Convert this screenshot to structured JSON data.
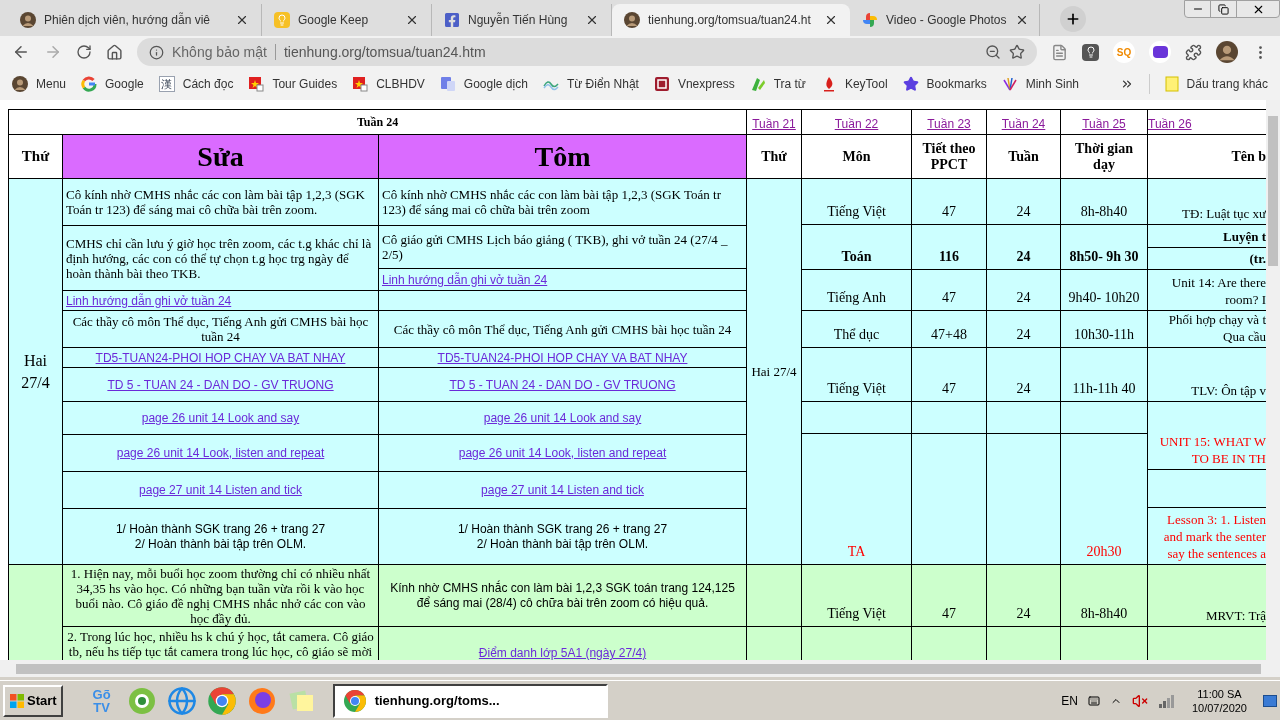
{
  "tabs": [
    {
      "title": "Phiên dịch viên, hướng dẫn viê",
      "kind": "avatar",
      "selected": false
    },
    {
      "title": "Google Keep",
      "kind": "keep",
      "selected": false
    },
    {
      "title": "Nguyễn Tiến Hùng",
      "kind": "facebook",
      "selected": false
    },
    {
      "title": "tienhung.org/tomsua/tuan24.ht",
      "kind": "avatar",
      "selected": true
    },
    {
      "title": "Video - Google Photos",
      "kind": "photos",
      "selected": false
    }
  ],
  "address_bar": {
    "security": "Không bảo mật",
    "url": "tienhung.org/tomsua/tuan24.htm"
  },
  "extension_badge": "SQ",
  "bookmarks": [
    {
      "label": "Menu",
      "kind": "avatar"
    },
    {
      "label": "Google",
      "kind": "google"
    },
    {
      "label": "Cách đọc",
      "kind": "glyph",
      "glyph": "漢"
    },
    {
      "label": "Tour Guides",
      "kind": "flag"
    },
    {
      "label": "CLBHDV",
      "kind": "flag"
    },
    {
      "label": "Google dịch",
      "kind": "translate"
    },
    {
      "label": "Từ Điển Nhật",
      "kind": "wave"
    },
    {
      "label": "Vnexpress",
      "kind": "news"
    },
    {
      "label": "Tra từ",
      "kind": "leaf"
    },
    {
      "label": "KeyTool",
      "kind": "flame"
    },
    {
      "label": "Bookmarks",
      "kind": "star"
    },
    {
      "label": "Minh Sinh",
      "kind": "fan"
    }
  ],
  "other_bookmarks": "Dấu trang khác",
  "left_table": {
    "title": "Tuần 24",
    "headers": [
      "Thứ",
      "Sửa",
      "Tôm"
    ],
    "blocks": [
      {
        "day": "Hai 27/4",
        "sua": [
          {
            "kind": "text",
            "text": "Cô kính nhờ CMHS nhắc các con làm bài tập 1,2,3 (SGK Toán tr 123) để sáng mai cô chữa bài trên zoom."
          },
          {
            "kind": "text",
            "text": "CMHS chỉ cần lưu ý giờ học trên zoom, các t.g khác chỉ là định hướng, các con có thể tự chọn t.g học trg ngày để hoàn thành bài theo TKB."
          },
          {
            "kind": "link",
            "text": "Linh hướng dẫn ghi vở tuần 24"
          },
          {
            "kind": "text",
            "text": "Các thầy cô môn Thể dục, Tiếng Anh gửi CMHS bài học tuần 24"
          },
          {
            "kind": "link",
            "text": "TD5-TUAN24-PHOI HOP CHAY VA BAT NHAY"
          },
          {
            "kind": "link",
            "text": "TD 5 - TUAN 24 - DAN DO - GV TRUONG"
          },
          {
            "kind": "link",
            "text": "page 26 unit 14 Look and say"
          },
          {
            "kind": "link",
            "text": "page 26 unit 14 Look, listen and repeat"
          },
          {
            "kind": "link",
            "text": "page 27 unit 14 Listen and tick"
          },
          {
            "kind": "note",
            "text": "1/ Hoàn thành SGK trang 26 + trang 27\n2/ Hoàn thành bài tập trên OLM."
          }
        ],
        "tom": [
          {
            "kind": "text",
            "text": "Cô kính nhờ CMHS nhắc các con làm bài tập 1,2,3 (SGK Toán tr 123) để sáng mai cô chữa bài trên zoom"
          },
          {
            "kind": "text",
            "text": "Cô giáo gửi CMHS Lịch báo giảng ( TKB), ghi vở tuần 24 (27/4 _ 2/5)"
          },
          {
            "kind": "link",
            "text": "Linh hướng dẫn ghi vở tuần 24"
          },
          {
            "kind": "empty"
          },
          {
            "kind": "text",
            "text": "Các thầy cô môn Thể dục, Tiếng Anh gửi CMHS bài học tuần 24"
          },
          {
            "kind": "link",
            "text": "TD5-TUAN24-PHOI HOP CHAY VA BAT NHAY"
          },
          {
            "kind": "link",
            "text": "TD 5 - TUAN 24 - DAN DO - GV TRUONG"
          },
          {
            "kind": "link",
            "text": "page 26 unit 14 Look and say"
          },
          {
            "kind": "link",
            "text": "page 26 unit 14 Look, listen and repeat"
          },
          {
            "kind": "link",
            "text": "page 27 unit 14 Listen and tick"
          },
          {
            "kind": "note",
            "text": "1/ Hoàn thành SGK trang 26 + trang 27\n2/ Hoàn thành bài tập trên OLM."
          }
        ]
      },
      {
        "sua": [
          {
            "kind": "text",
            "text": "1. Hiện nay, mỗi buổi học zoom thường chỉ có nhiều nhất 34,35 hs vào học. Có những bạn tuần vừa rồi k vào học buổi nào. Cô giáo đề nghị CMHS nhắc nhở các con vào học đầy đủ."
          },
          {
            "kind": "text",
            "text": "2. Trong lúc học, nhiều hs k chú ý học, tắt camera. Cô giáo tb, nếu hs tiếp tục tắt camera trong lúc học, cô giáo sẽ mời"
          }
        ],
        "tom": [
          {
            "kind": "note",
            "text": "Kính nhờ CMHS nhắc con làm bài 1,2,3 SGK toán trang 124,125 để sáng mai (28/4) cô chữa bài trên zoom có hiệu quả."
          },
          {
            "kind": "link",
            "text": "Điểm danh lớp 5A1 (ngày 27/4)"
          }
        ]
      }
    ]
  },
  "right_table": {
    "week_links": [
      "Tuần 21",
      "Tuần 22",
      "Tuần 23",
      "Tuần 24",
      "Tuần 25",
      "Tuần 26"
    ],
    "headers": [
      "Thứ",
      "Môn",
      "Tiết theo PPCT",
      "Tuần",
      "Thời gian dạy",
      "Tên b"
    ],
    "blocks": [
      {
        "day": "Hai 27/4",
        "lessons": [
          {
            "kind": "regular",
            "subject": "Tiếng Việt",
            "period": "47",
            "week": "24",
            "time": "8h-8h40"
          },
          {
            "kind": "bold",
            "subject": "Toán",
            "period": "116",
            "week": "24",
            "time": "8h50- 9h 30"
          },
          {
            "kind": "regular",
            "subject": "Tiếng Anh",
            "period": "47",
            "week": "24",
            "time": "9h40- 10h20"
          },
          {
            "kind": "regular",
            "subject": "Thể dục",
            "period": "47+48",
            "week": "24",
            "time": "10h30-11h"
          },
          {
            "kind": "regular",
            "subject": "Tiếng Việt",
            "period": "47",
            "week": "24",
            "time": "11h-11h 40"
          },
          {
            "kind": "empty"
          },
          {
            "kind": "online",
            "subject": "TA",
            "time": "20h30"
          }
        ],
        "titles": [
          {
            "kind": "regular",
            "text": "TĐ: Luật tục xư"
          },
          {
            "kind": "bold",
            "text": "Luyện t"
          },
          {
            "kind": "bold",
            "text": "(tr."
          },
          {
            "kind": "regular",
            "text": "Unit 14: Are there\nroom? I"
          },
          {
            "kind": "regular",
            "text": "Phối hợp chạy và t\nQua cầu"
          },
          {
            "kind": "regular",
            "text": "TLV: Ôn tập v"
          },
          {
            "kind": "online",
            "text": "UNIT 15: WHAT W\nTO BE IN TH"
          },
          {
            "kind": "empty"
          },
          {
            "kind": "online",
            "text": "Lesson 3: 1. Listen\nand mark the senter\nsay the sentences a"
          }
        ]
      },
      {
        "lessons": [
          {
            "kind": "regular",
            "subject": "Tiếng Việt",
            "period": "47",
            "week": "24",
            "time": "8h-8h40"
          }
        ],
        "titles": [
          {
            "kind": "regular",
            "text": "MRVT: Trậ"
          }
        ]
      }
    ]
  },
  "taskbar": {
    "start": "Start",
    "logo_text": "Gõ TV",
    "window": "tienhung.org/toms...",
    "language": "EN",
    "time": "11:00 SA",
    "date": "10/07/2020"
  }
}
